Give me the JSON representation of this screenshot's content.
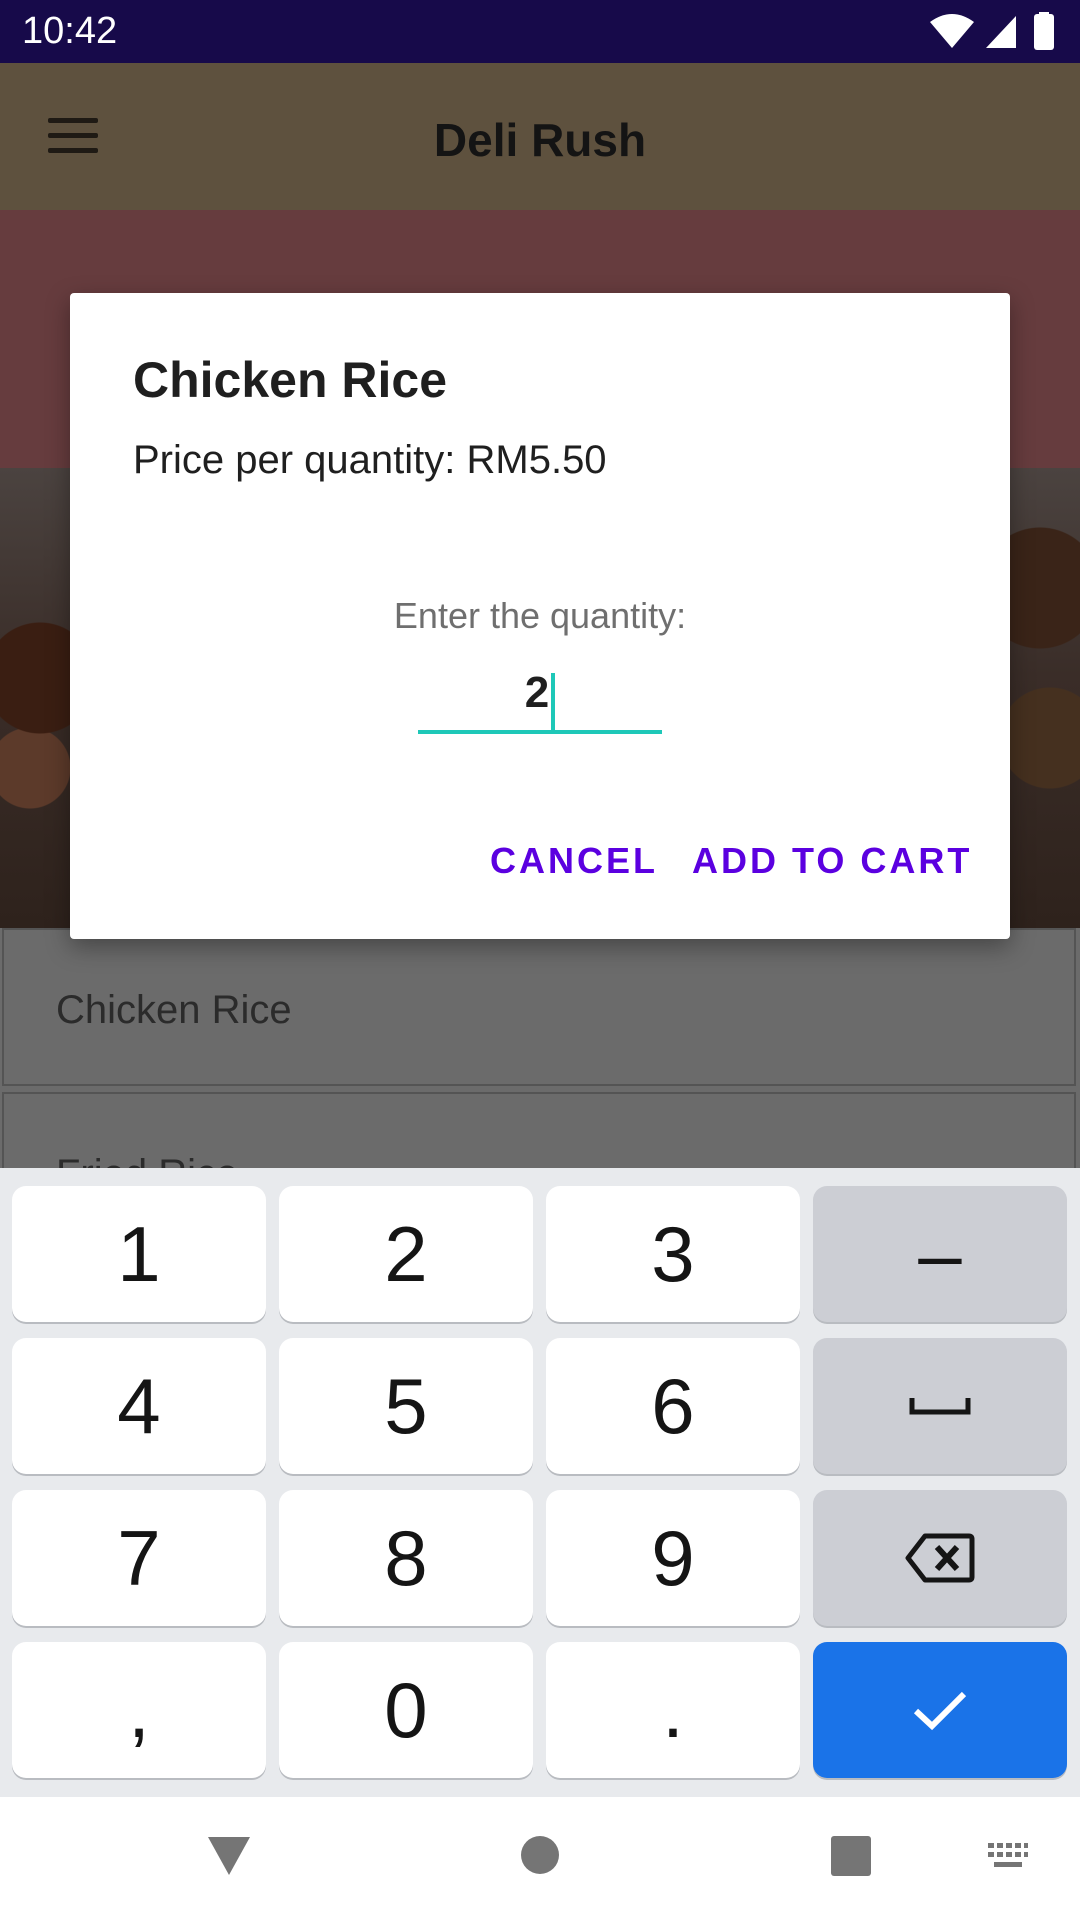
{
  "status_bar": {
    "time": "10:42",
    "icons": [
      "wifi-icon",
      "signal-icon",
      "battery-icon"
    ],
    "background": "#170a4a"
  },
  "app_bar": {
    "title": "Deli Rush",
    "menu_icon": "menu-icon",
    "background": "#5e513e"
  },
  "banner": {
    "background": "#663c3e"
  },
  "list": {
    "items": [
      "Chicken Rice",
      "Fried Rice"
    ]
  },
  "dialog": {
    "title": "Chicken Rice",
    "message": "Price per quantity: RM5.50",
    "quantity_label": "Enter the quantity:",
    "quantity_value": "2",
    "cancel_label": "CANCEL",
    "confirm_label": "ADD TO CART",
    "accent_color": "#5b00e0",
    "field_color": "#1ec8b8"
  },
  "keyboard": {
    "rows": [
      [
        "1",
        "2",
        "3",
        "–"
      ],
      [
        "4",
        "5",
        "6",
        "space-icon"
      ],
      [
        "7",
        "8",
        "9",
        "backspace-icon"
      ],
      [
        ",",
        "0",
        ".",
        "check-icon"
      ]
    ],
    "enter_color": "#1a73e8"
  },
  "nav_bar": {
    "icons": [
      "back-icon",
      "home-icon",
      "recents-icon",
      "keyboard-switch-icon"
    ]
  }
}
